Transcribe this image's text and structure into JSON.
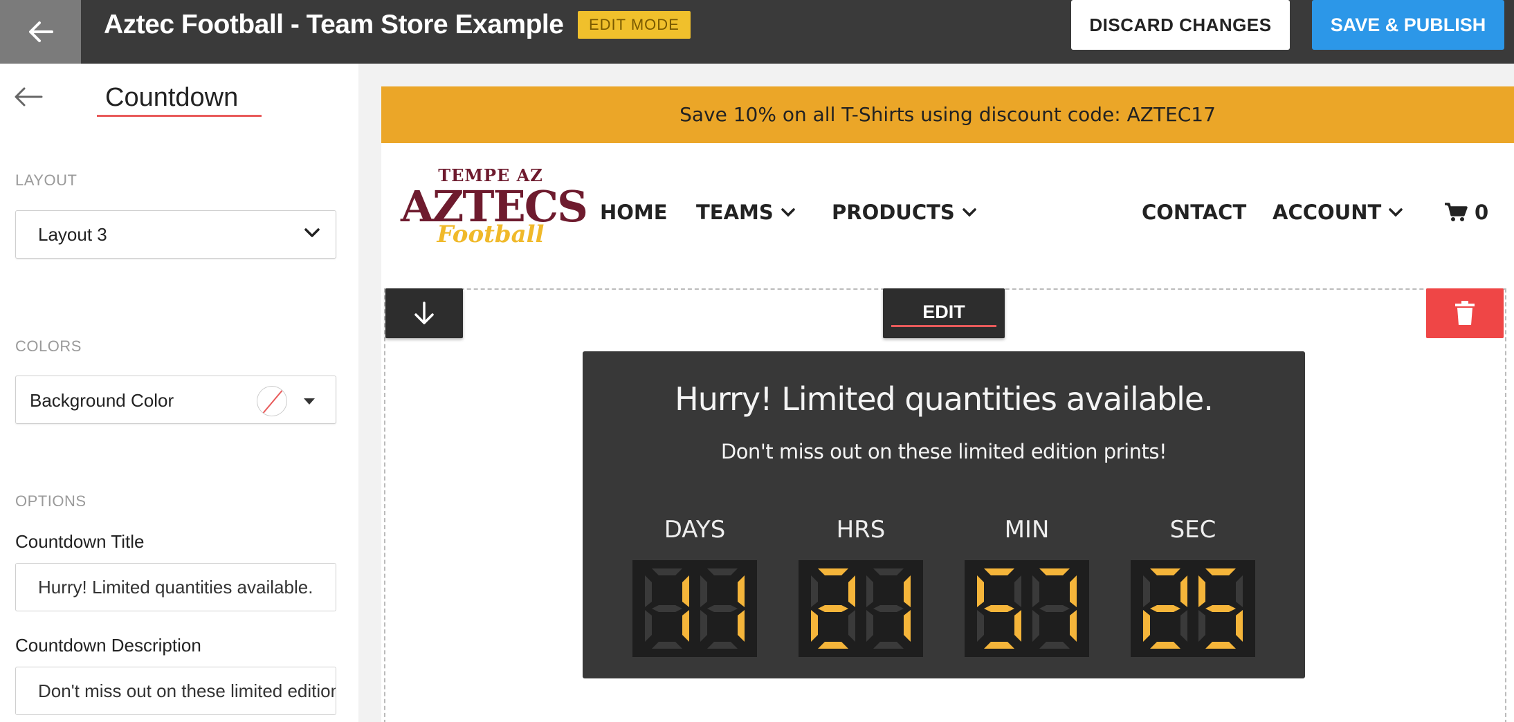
{
  "topbar": {
    "title": "Aztec Football - Team Store Example",
    "badge": "EDIT MODE",
    "discard_label": "DISCARD CHANGES",
    "save_label": "SAVE & PUBLISH"
  },
  "sidebar": {
    "title": "Countdown",
    "layout_section": "LAYOUT",
    "layout_value": "Layout 3",
    "colors_section": "COLORS",
    "background_color_label": "Background Color",
    "options_section": "OPTIONS",
    "countdown_title_label": "Countdown Title",
    "countdown_title_value": "Hurry! Limited quantities available.",
    "countdown_description_label": "Countdown Description",
    "countdown_description_value": "Don't miss out on these limited edition prints!"
  },
  "store": {
    "promo": "Save 10% on all T-Shirts using discount code: AZTEC17",
    "logo": {
      "top": "TEMPE AZ",
      "main": "AZTECS",
      "script": "Football"
    },
    "nav": {
      "home": "HOME",
      "teams": "TEAMS",
      "products": "PRODUCTS",
      "contact": "CONTACT",
      "account": "ACCOUNT",
      "cart_count": "0"
    },
    "edit_label": "EDIT"
  },
  "countdown": {
    "title": "Hurry! Limited quantities available.",
    "description": "Don't miss out on these limited edition prints!",
    "units": [
      {
        "label": "DAYS",
        "value": "11"
      },
      {
        "label": "HRS",
        "value": "21"
      },
      {
        "label": "MIN",
        "value": "57"
      },
      {
        "label": "SEC",
        "value": "25"
      }
    ],
    "digit_on_color": "#f5b53a",
    "digit_off_color": "#3a3a3a"
  },
  "colors": {
    "topbar": "#3a3a3a",
    "save_button": "#2c97e8",
    "promo_bar": "#eba628",
    "delete_button": "#ef4646",
    "accent_underline": "#e85a5a"
  }
}
